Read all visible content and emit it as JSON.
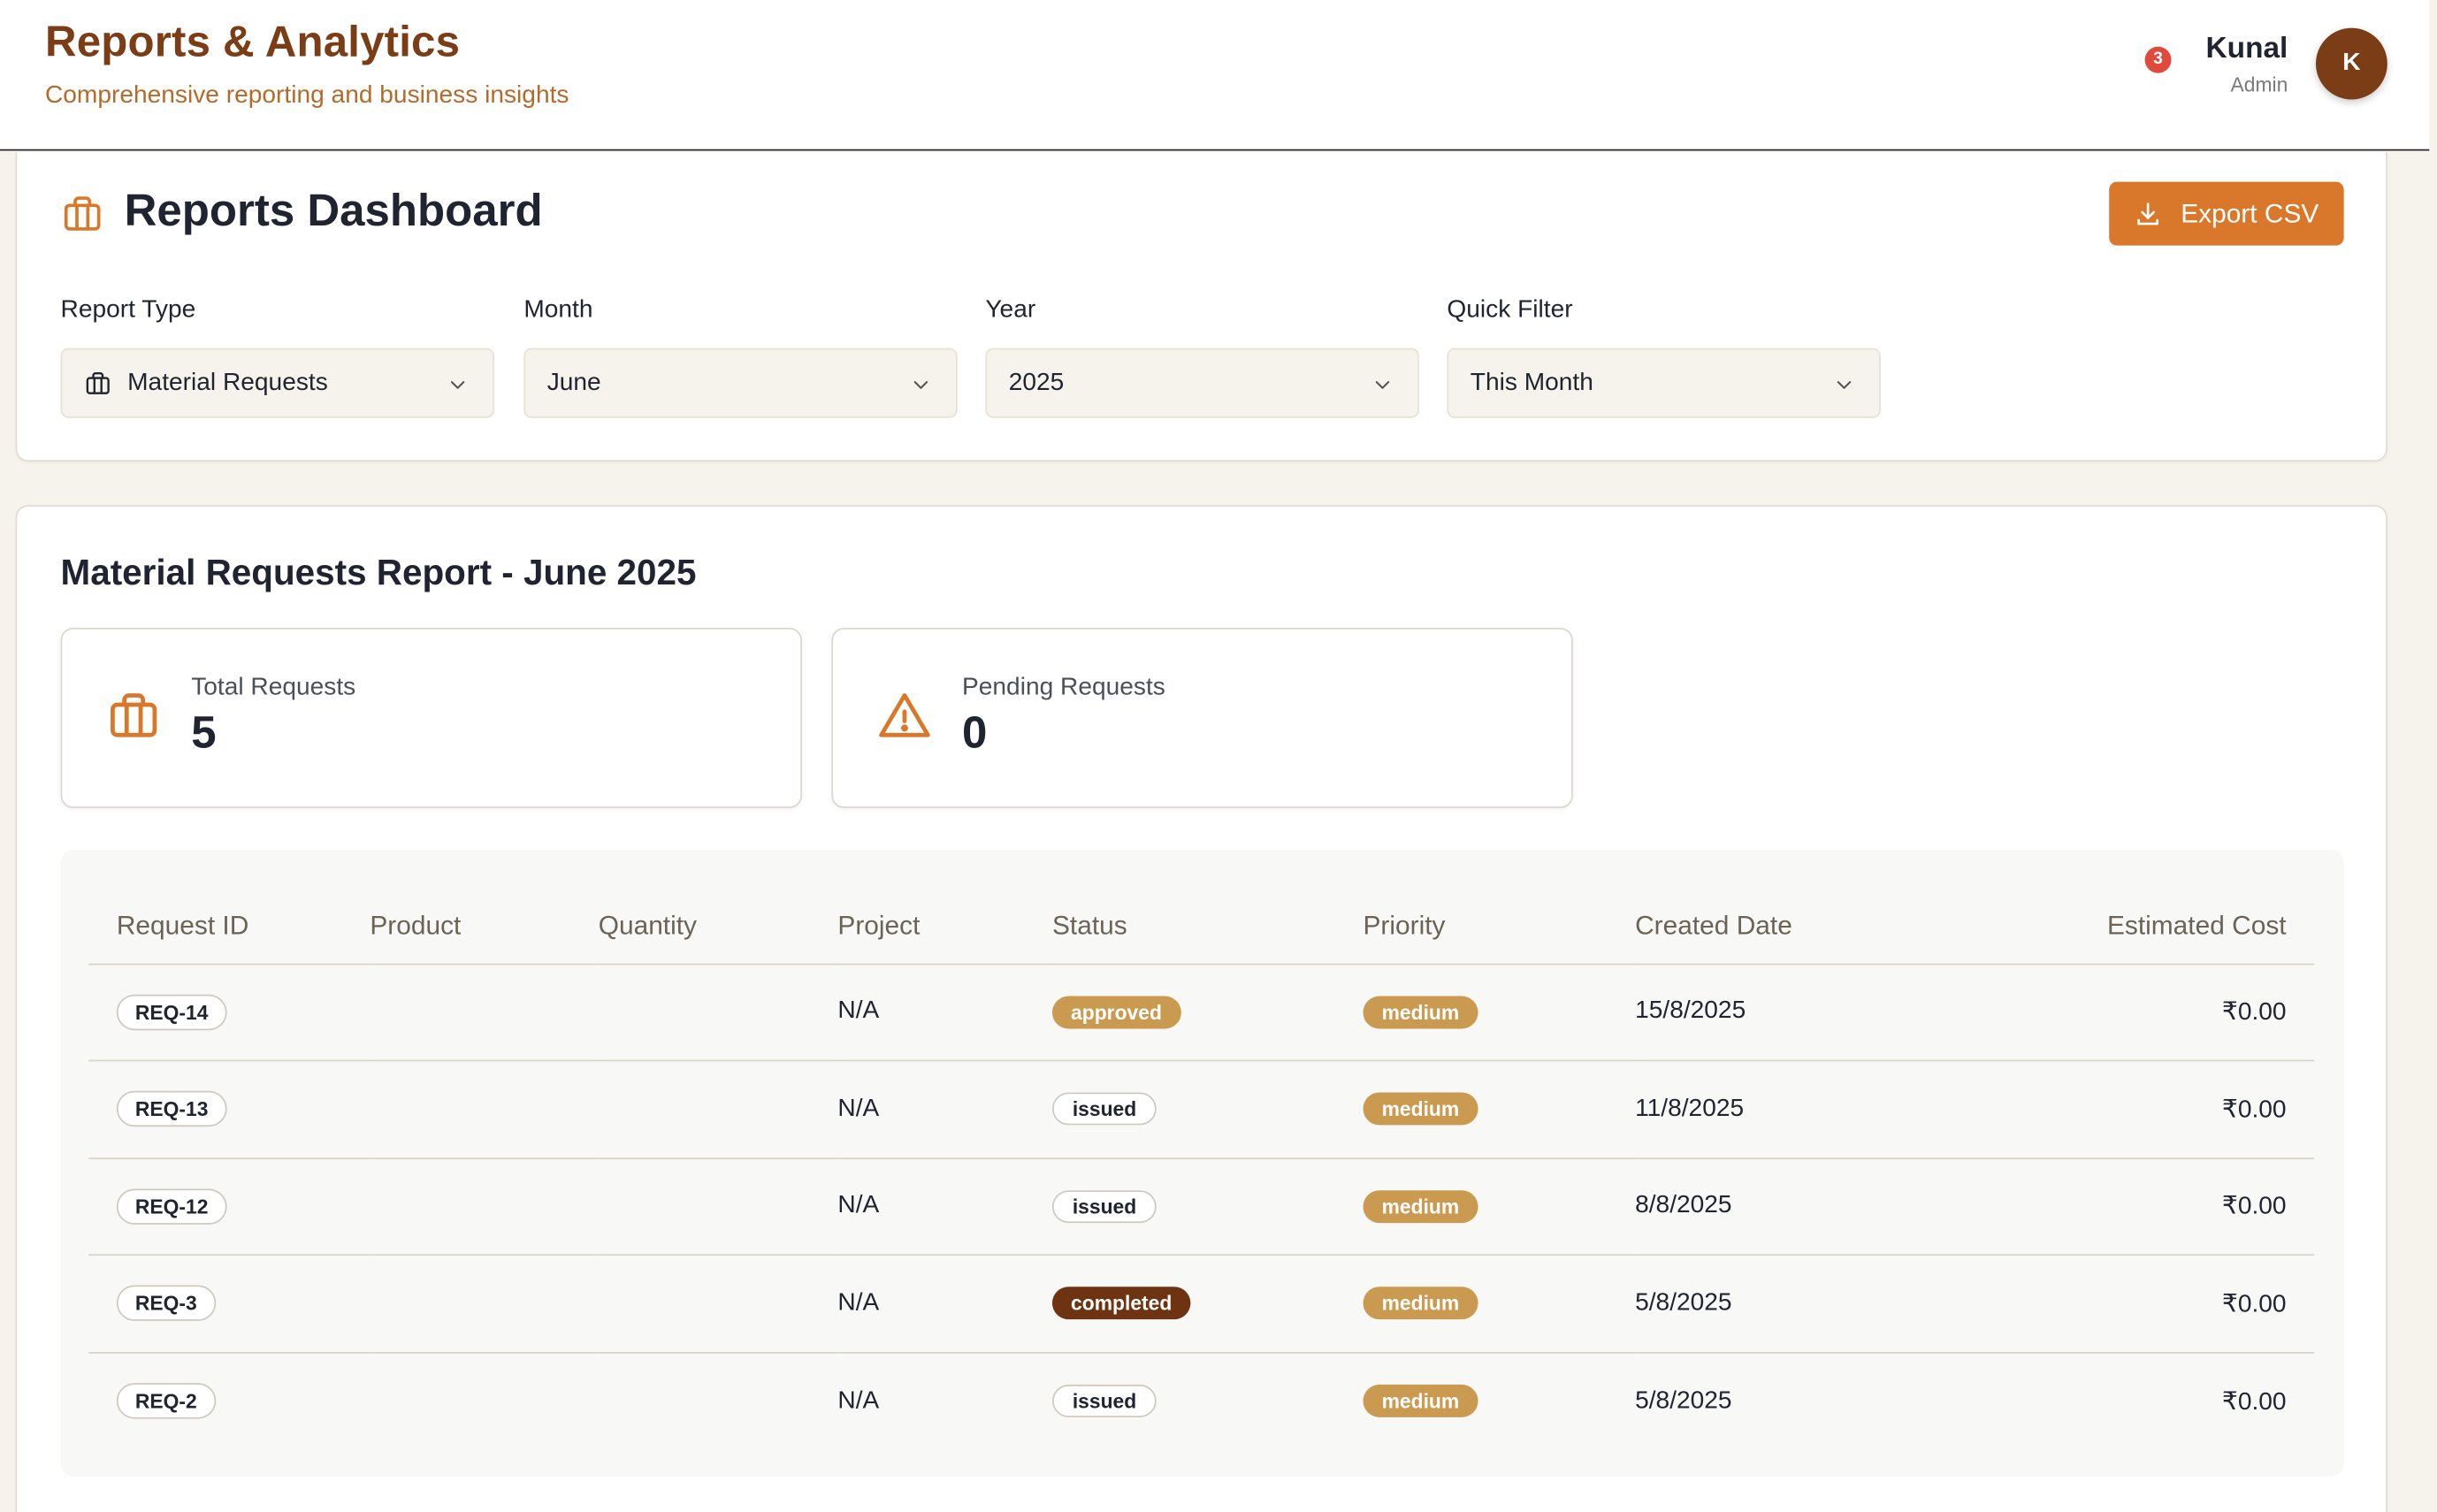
{
  "header": {
    "title": "Reports & Analytics",
    "subtitle": "Comprehensive reporting and business insights",
    "notification_count": "3",
    "user": {
      "name": "Kunal",
      "role": "Admin",
      "initial": "K"
    }
  },
  "dashboard": {
    "title": "Reports Dashboard",
    "export_label": "Export CSV",
    "filters": [
      {
        "label": "Report Type",
        "value": "Material Requests",
        "icon": "briefcase-icon"
      },
      {
        "label": "Month",
        "value": "June"
      },
      {
        "label": "Year",
        "value": "2025"
      },
      {
        "label": "Quick Filter",
        "value": "This Month"
      }
    ]
  },
  "report": {
    "title": "Material Requests Report - June 2025",
    "stats": [
      {
        "label": "Total Requests",
        "value": "5",
        "icon": "briefcase-icon"
      },
      {
        "label": "Pending Requests",
        "value": "0",
        "icon": "warning-triangle-icon"
      }
    ],
    "columns": [
      "Request ID",
      "Product",
      "Quantity",
      "Project",
      "Status",
      "Priority",
      "Created Date",
      "Estimated Cost"
    ],
    "rows": [
      {
        "id": "REQ-14",
        "product": "",
        "quantity": "",
        "project": "N/A",
        "status": "approved",
        "priority": "medium",
        "date": "15/8/2025",
        "cost": "₹0.00"
      },
      {
        "id": "REQ-13",
        "product": "",
        "quantity": "",
        "project": "N/A",
        "status": "issued",
        "priority": "medium",
        "date": "11/8/2025",
        "cost": "₹0.00"
      },
      {
        "id": "REQ-12",
        "product": "",
        "quantity": "",
        "project": "N/A",
        "status": "issued",
        "priority": "medium",
        "date": "8/8/2025",
        "cost": "₹0.00"
      },
      {
        "id": "REQ-3",
        "product": "",
        "quantity": "",
        "project": "N/A",
        "status": "completed",
        "priority": "medium",
        "date": "5/8/2025",
        "cost": "₹0.00"
      },
      {
        "id": "REQ-2",
        "product": "",
        "quantity": "",
        "project": "N/A",
        "status": "issued",
        "priority": "medium",
        "date": "5/8/2025",
        "cost": "₹0.00"
      }
    ]
  },
  "colors": {
    "brand": "#7a3d15",
    "accent": "#d9782a",
    "status_approved": "#c99a4f",
    "status_completed": "#6e3411",
    "priority_medium": "#c99a4f",
    "notification": "#e04a3d"
  }
}
